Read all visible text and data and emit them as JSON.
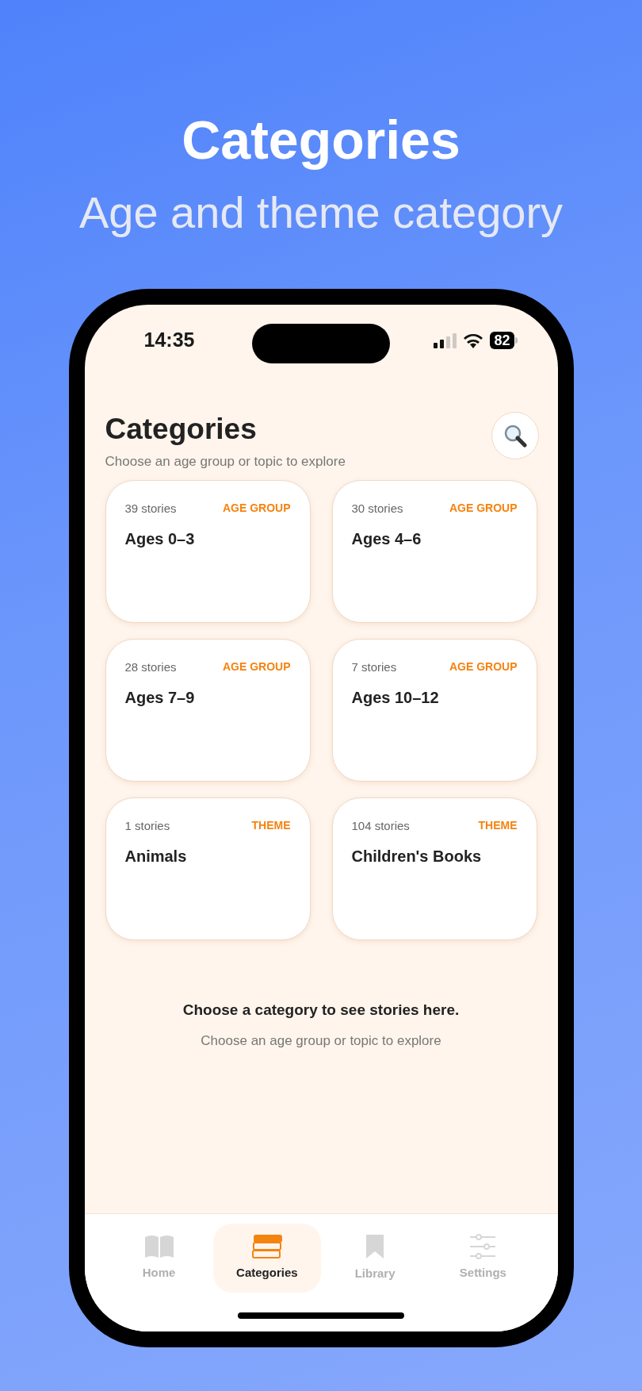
{
  "header": {
    "title": "Categories",
    "subtitle": "Age and theme category"
  },
  "status_bar": {
    "time": "14:35",
    "battery": "82"
  },
  "page": {
    "title": "Categories",
    "subtitle": "Choose an age group or topic to explore"
  },
  "categories": [
    {
      "count": "39 stories",
      "tag": "AGE GROUP",
      "name": "Ages 0–3"
    },
    {
      "count": "30 stories",
      "tag": "AGE GROUP",
      "name": "Ages 4–6"
    },
    {
      "count": "28 stories",
      "tag": "AGE GROUP",
      "name": "Ages 7–9"
    },
    {
      "count": "7 stories",
      "tag": "AGE GROUP",
      "name": "Ages 10–12"
    },
    {
      "count": "1 stories",
      "tag": "THEME",
      "name": "Animals"
    },
    {
      "count": "104 stories",
      "tag": "THEME",
      "name": "Children's Books"
    }
  ],
  "empty_state": {
    "title": "Choose a category to see stories here.",
    "subtitle": "Choose an age group or topic to explore"
  },
  "tabs": [
    {
      "label": "Home",
      "kind": "book",
      "selected": false
    },
    {
      "label": "Categories",
      "kind": "books",
      "selected": true
    },
    {
      "label": "Library",
      "kind": "bookmark",
      "selected": false
    },
    {
      "label": "Settings",
      "kind": "sliders",
      "selected": false
    }
  ]
}
